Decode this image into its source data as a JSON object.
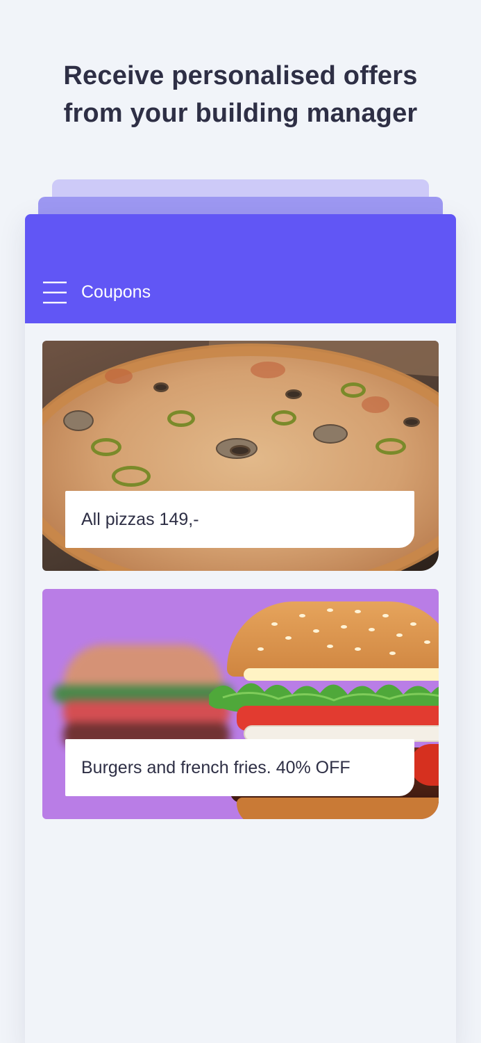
{
  "headline": {
    "line1": "Receive personalised offers",
    "line2": "from your building manager"
  },
  "app_bar": {
    "title": "Coupons",
    "menu_icon": "hamburger-menu-icon"
  },
  "coupons": [
    {
      "label": "All pizzas 149,-",
      "image": "pizza-photo"
    },
    {
      "label": "Burgers and french fries. 40% OFF",
      "image": "burger-photo"
    }
  ],
  "colors": {
    "background": "#f1f4f9",
    "app_bar": "#6156f5",
    "stack_layer_1": "#9d98f2",
    "stack_layer_2": "#cdcaf8",
    "headline_text": "#2e2f45",
    "burger_background": "#b97de6"
  }
}
